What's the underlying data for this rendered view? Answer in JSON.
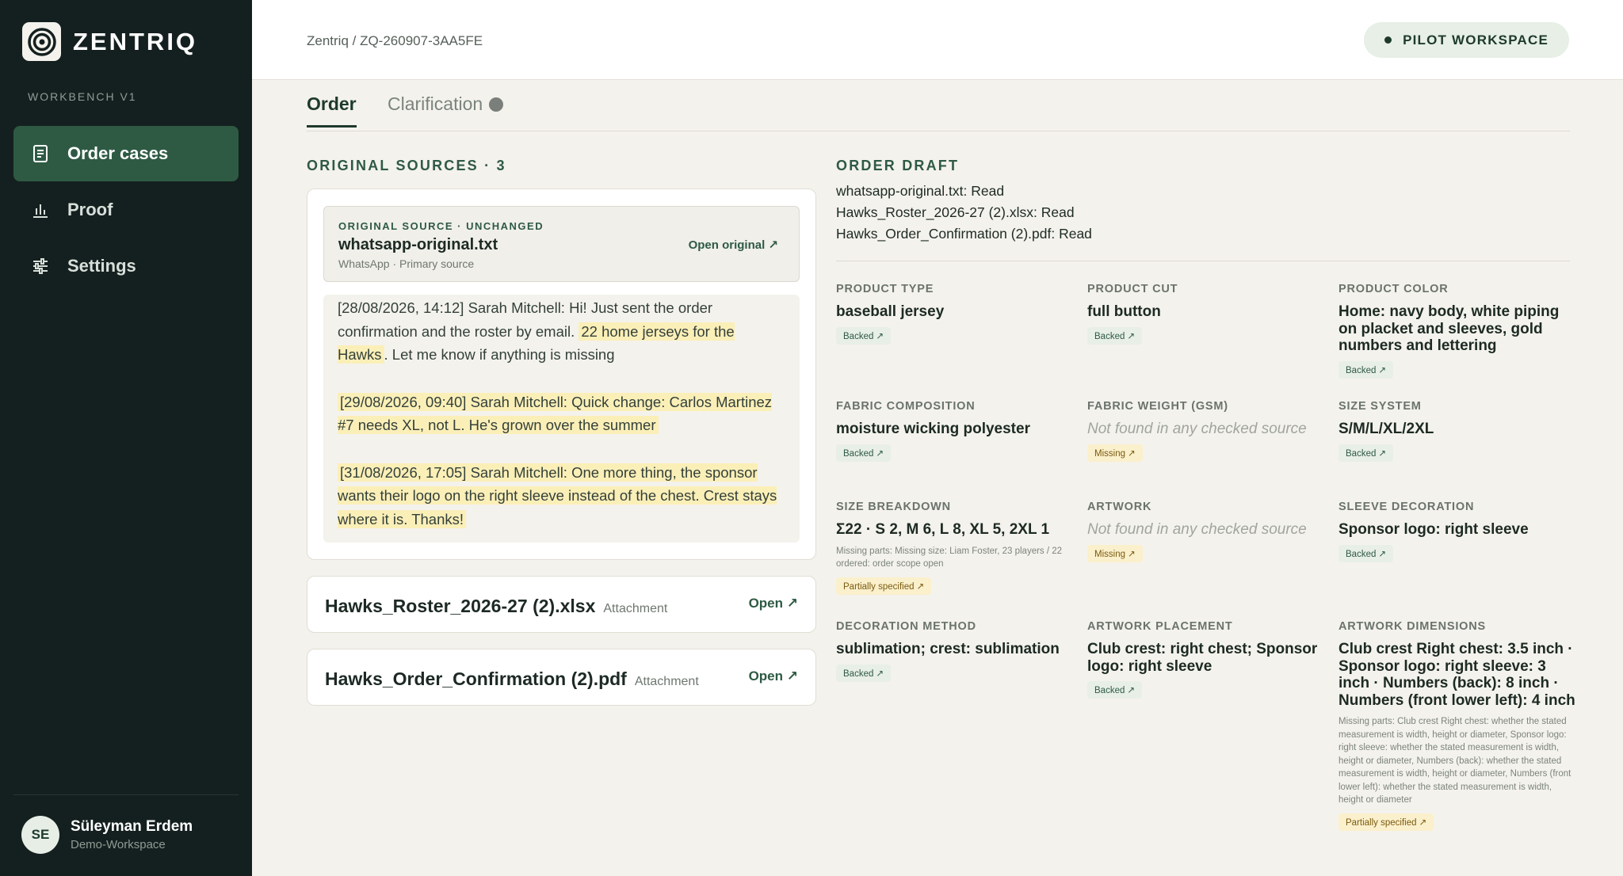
{
  "brand": {
    "name": "ZENTRIQ",
    "workbench": "WORKBENCH V1"
  },
  "sidebar": {
    "items": [
      {
        "label": "Order cases",
        "icon": "document-icon",
        "active": true
      },
      {
        "label": "Proof",
        "icon": "bar-chart-icon",
        "active": false
      },
      {
        "label": "Settings",
        "icon": "sliders-icon",
        "active": false
      }
    ]
  },
  "user": {
    "initials": "SE",
    "name": "Süleyman Erdem",
    "workspace": "Demo-Workspace"
  },
  "topbar": {
    "breadcrumb": "Zentriq / ZQ-260907-3AA5FE",
    "workspace_badge": "PILOT WORKSPACE"
  },
  "tabs": {
    "order": "Order",
    "clarification": "Clarification"
  },
  "sources": {
    "heading": "ORIGINAL SOURCES · 3",
    "primary": {
      "kicker": "ORIGINAL SOURCE · UNCHANGED",
      "title": "whatsapp-original.txt",
      "subtitle": "WhatsApp · Primary source",
      "open_label": "Open original ↗",
      "messages": [
        {
          "pre": "[28/08/2026, 14:12] Sarah Mitchell: Hi! Just sent the order confirmation and the roster by email. ",
          "highlight": "22 home jerseys for the Hawks",
          "post": ". Let me know if anything is missing"
        },
        {
          "pre": "",
          "highlight": "[29/08/2026, 09:40] Sarah Mitchell: Quick change: Carlos Martinez #7 needs XL, not L. He's grown over the summer",
          "post": ""
        },
        {
          "pre": "",
          "highlight": "[31/08/2026, 17:05] Sarah Mitchell: One more thing, the sponsor wants their logo on the right sleeve instead of the chest. Crest stays where it is. Thanks!",
          "post": ""
        }
      ]
    },
    "attachments": [
      {
        "name": "Hawks_Roster_2026-27 (2).xlsx",
        "tag": "Attachment",
        "open_label": "Open ↗"
      },
      {
        "name": "Hawks_Order_Confirmation (2).pdf",
        "tag": "Attachment",
        "open_label": "Open ↗"
      }
    ]
  },
  "draft": {
    "heading": "ORDER DRAFT",
    "status_lines": [
      "whatsapp-original.txt: Read",
      "Hawks_Roster_2026-27 (2).xlsx: Read",
      "Hawks_Order_Confirmation (2).pdf: Read"
    ],
    "fields": {
      "product_type": {
        "label": "PRODUCT TYPE",
        "value": "baseball jersey",
        "badge": "Backed ↗"
      },
      "product_cut": {
        "label": "PRODUCT CUT",
        "value": "full button",
        "badge": "Backed ↗"
      },
      "product_color": {
        "label": "PRODUCT COLOR",
        "value": "Home: navy body, white piping on placket and sleeves, gold numbers and lettering",
        "badge": "Backed ↗"
      },
      "fabric_composition": {
        "label": "FABRIC COMPOSITION",
        "value": "moisture wicking polyester",
        "badge": "Backed ↗"
      },
      "fabric_weight": {
        "label": "FABRIC WEIGHT (GSM)",
        "value": "Not found in any checked source",
        "badge": "Missing ↗"
      },
      "size_system": {
        "label": "SIZE SYSTEM",
        "value": "S/M/L/XL/2XL",
        "badge": "Backed ↗"
      },
      "size_breakdown": {
        "label": "SIZE BREAKDOWN",
        "value": "Σ22 · S 2, M 6, L 8, XL 5, 2XL 1",
        "note": "Missing parts: Missing size: Liam Foster, 23 players / 22 ordered: order scope open",
        "badge": "Partially specified ↗"
      },
      "artwork": {
        "label": "ARTWORK",
        "value": "Not found in any checked source",
        "badge": "Missing ↗"
      },
      "sleeve_decoration": {
        "label": "SLEEVE DECORATION",
        "value": "Sponsor logo: right sleeve",
        "badge": "Backed ↗"
      },
      "decoration_method": {
        "label": "DECORATION METHOD",
        "value": "sublimation; crest: sublimation",
        "badge": "Backed ↗"
      },
      "artwork_placement": {
        "label": "ARTWORK PLACEMENT",
        "value": "Club crest: right chest; Sponsor logo: right sleeve",
        "badge": "Backed ↗"
      },
      "artwork_dimensions": {
        "label": "ARTWORK DIMENSIONS",
        "value": "Club crest Right chest: 3.5 inch · Sponsor logo: right sleeve: 3 inch · Numbers (back): 8 inch · Numbers (front lower left): 4 inch",
        "note": "Missing parts: Club crest Right chest: whether the stated measurement is width, height or diameter, Sponsor logo: right sleeve: whether the stated measurement is width, height or diameter, Numbers (back): whether the stated measurement is width, height or diameter, Numbers (front lower left): whether the stated measurement is width, height or diameter",
        "badge": "Partially specified ↗"
      }
    }
  }
}
